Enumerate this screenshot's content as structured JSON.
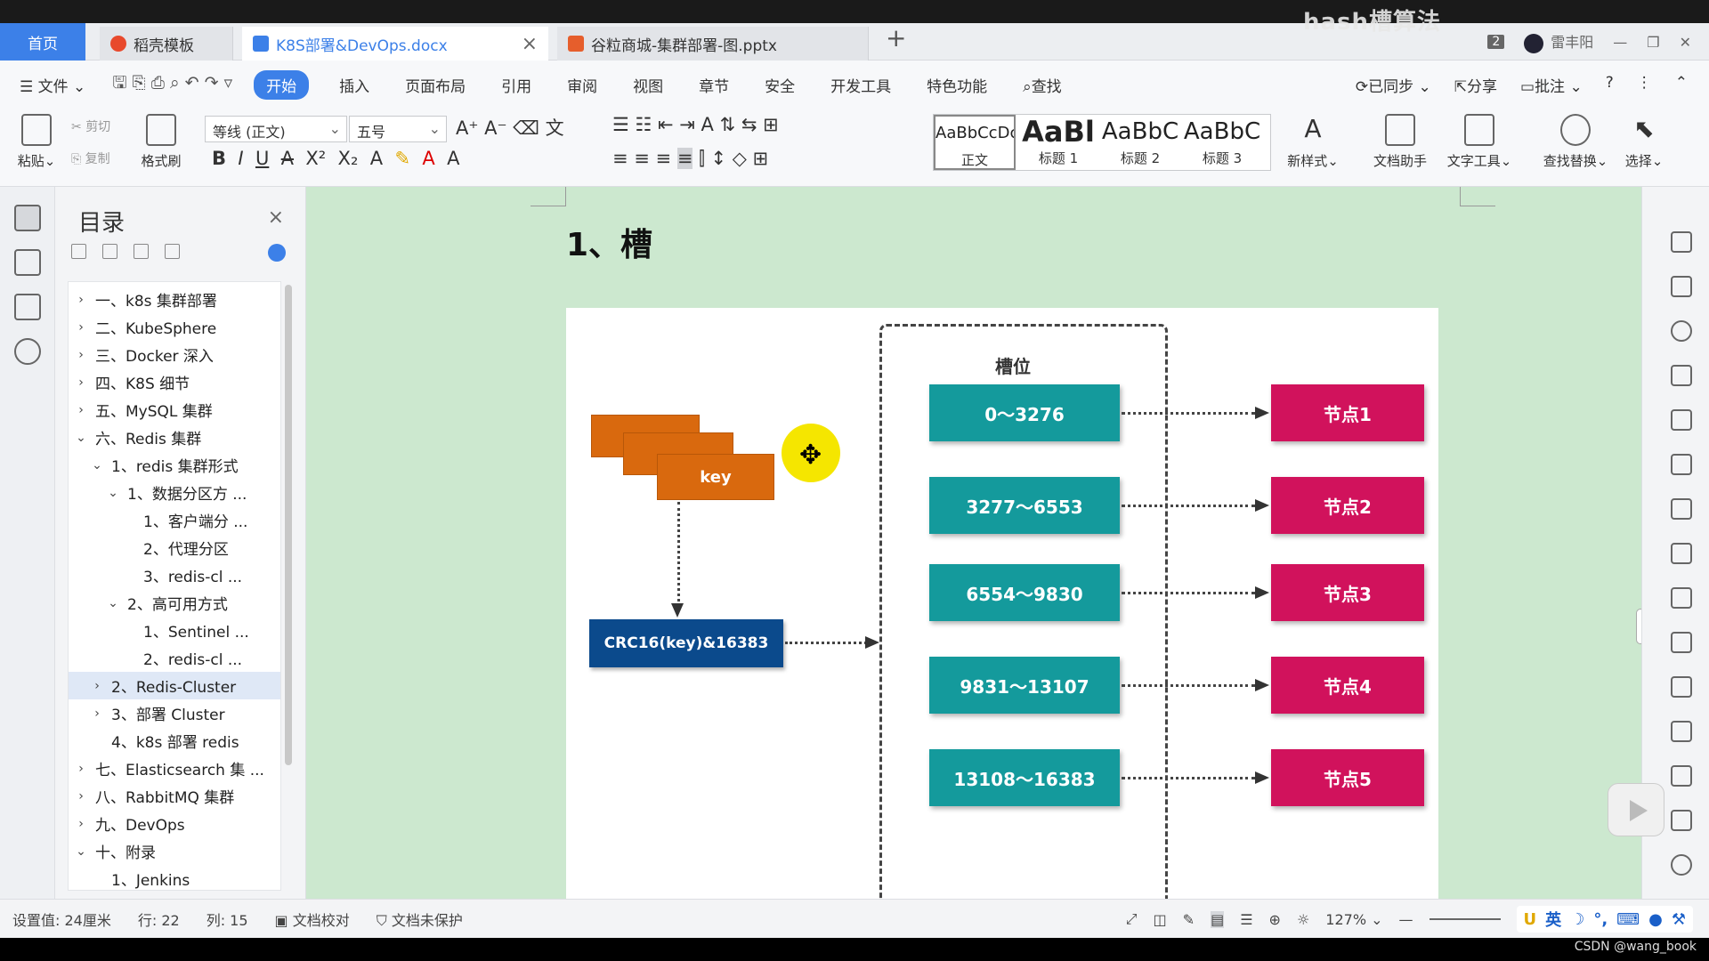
{
  "overlay_title": "hash槽算法",
  "tabs": [
    {
      "label": "首页",
      "type": "home"
    },
    {
      "label": "稻壳模板",
      "type": "inactive",
      "icon": "docer-icon",
      "color": "#e8492c"
    },
    {
      "label": "K8S部署&DevOps.docx",
      "type": "active",
      "icon": "word-doc-icon",
      "color": "#3c80e8"
    },
    {
      "label": "谷粒商城-集群部署-图.pptx",
      "type": "inactive",
      "icon": "ppt-icon",
      "color": "#e65e2c"
    }
  ],
  "window": {
    "badge": "2",
    "user": "雷丰阳"
  },
  "menu": {
    "file": "文件",
    "items": [
      "开始",
      "插入",
      "页面布局",
      "引用",
      "审阅",
      "视图",
      "章节",
      "安全",
      "开发工具",
      "特色功能"
    ],
    "active": "开始",
    "search": "查找",
    "right": [
      "已同步",
      "分享",
      "批注"
    ]
  },
  "ribbon": {
    "paste": "粘贴",
    "cut": "剪切",
    "copy": "复制",
    "format_painter": "格式刷",
    "font": "等线 (正文)",
    "size": "五号",
    "styles": [
      {
        "sample": "AaBbCcDc",
        "name": "正文"
      },
      {
        "sample": "AaBl",
        "name": "标题 1"
      },
      {
        "sample": "AaBbC",
        "name": "标题 2"
      },
      {
        "sample": "AaBbC",
        "name": "标题 3"
      }
    ],
    "new_style": "新样式",
    "doc_helper": "文档助手",
    "text_tools": "文字工具",
    "find_replace": "查找替换",
    "select": "选择"
  },
  "toc": {
    "title": "目录",
    "items": [
      {
        "label": "一、k8s 集群部署",
        "level": 0,
        "arrow": "›"
      },
      {
        "label": "二、KubeSphere",
        "level": 0,
        "arrow": "›"
      },
      {
        "label": "三、Docker 深入",
        "level": 0,
        "arrow": "›"
      },
      {
        "label": "四、K8S 细节",
        "level": 0,
        "arrow": "›"
      },
      {
        "label": "五、MySQL 集群",
        "level": 0,
        "arrow": "›"
      },
      {
        "label": "六、Redis 集群",
        "level": 0,
        "arrow": "⌄"
      },
      {
        "label": "1、redis 集群形式",
        "level": 1,
        "arrow": "⌄"
      },
      {
        "label": "1、数据分区方 ...",
        "level": 2,
        "arrow": "⌄"
      },
      {
        "label": "1、客户端分 ...",
        "level": 3,
        "arrow": ""
      },
      {
        "label": "2、代理分区",
        "level": 3,
        "arrow": ""
      },
      {
        "label": "3、redis-cl ...",
        "level": 3,
        "arrow": ""
      },
      {
        "label": "2、高可用方式",
        "level": 2,
        "arrow": "⌄"
      },
      {
        "label": "1、Sentinel ...",
        "level": 3,
        "arrow": ""
      },
      {
        "label": "2、redis-cl ...",
        "level": 3,
        "arrow": ""
      },
      {
        "label": "2、Redis-Cluster",
        "level": 1,
        "arrow": "›",
        "selected": true
      },
      {
        "label": "3、部署 Cluster",
        "level": 1,
        "arrow": "›"
      },
      {
        "label": "4、k8s 部署 redis",
        "level": 1,
        "arrow": ""
      },
      {
        "label": "七、Elasticsearch 集 ...",
        "level": 0,
        "arrow": "›"
      },
      {
        "label": "八、RabbitMQ 集群",
        "level": 0,
        "arrow": "›"
      },
      {
        "label": "九、DevOps",
        "level": 0,
        "arrow": "›"
      },
      {
        "label": "十、附录",
        "level": 0,
        "arrow": "⌄"
      },
      {
        "label": "1、Jenkins",
        "level": 1,
        "arrow": ""
      }
    ]
  },
  "document": {
    "heading": "1、槽",
    "diagram": {
      "key": "key",
      "crc": "CRC16(key)&16383",
      "slot_title": "槽位",
      "slots": [
        "0～3276",
        "3277～6553",
        "6554～9830",
        "9831～13107",
        "13108～16383"
      ],
      "nodes": [
        "节点1",
        "节点2",
        "节点3",
        "节点4",
        "节点5"
      ],
      "colors": {
        "key": "#d9690e",
        "crc": "#0b4a8c",
        "slot": "#149a9c",
        "node": "#d1125c"
      }
    }
  },
  "status": {
    "setting": "设置值: 24厘米",
    "row": "行: 22",
    "col": "列: 15",
    "proofread": "文档校对",
    "protect": "文档未保护",
    "zoom": "127%",
    "ime": "英"
  },
  "watermark": "CSDN @wang_book"
}
